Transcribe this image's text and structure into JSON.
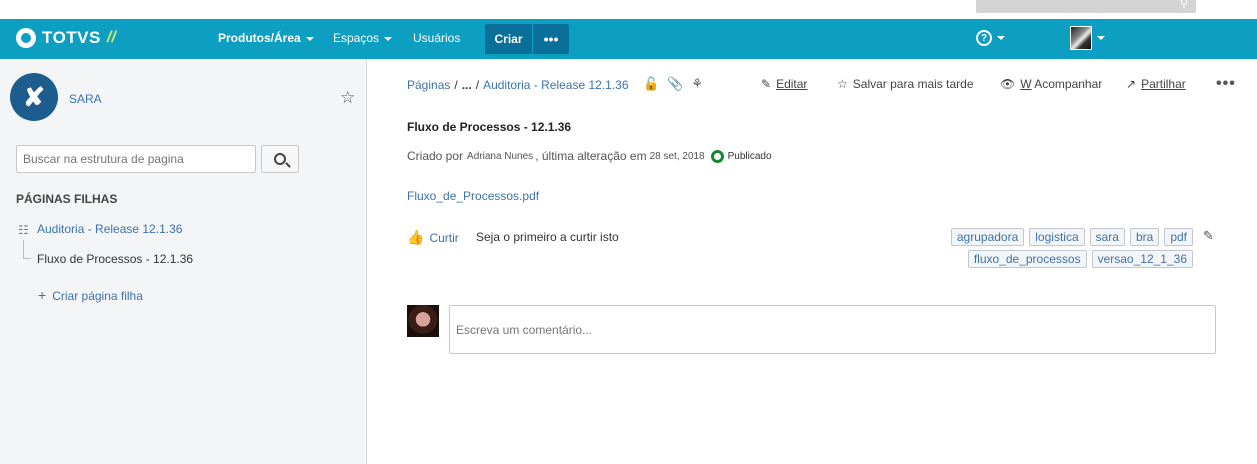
{
  "nav": {
    "logo_text": "TOTVS",
    "logo_slash": "//",
    "items": [
      {
        "label": "Produtos/Área"
      },
      {
        "label": "Espaços"
      },
      {
        "label": "Usuários"
      }
    ],
    "create_label": "Criar",
    "more_label": "•••",
    "help_label": "?",
    "accent_color": "#0d9fc2"
  },
  "sidebar": {
    "space_name": "SARA",
    "search_placeholder": "Buscar na estrutura de pagina",
    "child_pages_title": "PÁGINAS FILHAS",
    "tree": {
      "parent": "Auditoria - Release 12.1.36",
      "child": "Fluxo de Processos - 12.1.36"
    },
    "create_child_label": "Criar página filha"
  },
  "breadcrumb": {
    "root": "Páginas",
    "sep": "/",
    "ellipsis": "...",
    "parent": "Auditoria - Release 12.1.36"
  },
  "actions": {
    "edit": "Editar",
    "save_later": "Salvar para mais tarde",
    "watch_prefix": "W",
    "watch_rest": " Acompanhar",
    "share": "Partilhar",
    "more": "•••"
  },
  "page": {
    "title": "Fluxo de Processos - 12.1.36",
    "meta_prefix": "Criado por",
    "author": "Adriana Nunes",
    "meta_mid": ", última alteração em",
    "date": "28 set, 2018",
    "status": "Publicado",
    "attachment": "Fluxo_de_Processos.pdf",
    "like_label": "Curtir",
    "like_text": "Seja o primeiro a curtir isto",
    "labels": [
      "agrupadora",
      "logistica",
      "sara",
      "bra",
      "pdf",
      "fluxo_de_processos",
      "versao_12_1_36"
    ],
    "comment_placeholder": "Escreva um comentário..."
  }
}
